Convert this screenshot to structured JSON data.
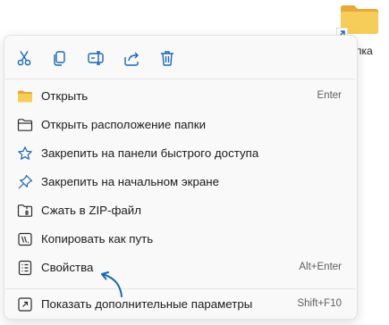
{
  "desktop": {
    "folder_label": "пка"
  },
  "toolbar": {
    "buttons": [
      {
        "icon": "cut-icon",
        "label": "Вырезать"
      },
      {
        "icon": "copy-icon",
        "label": "Копировать"
      },
      {
        "icon": "rename-icon",
        "label": "Переименовать"
      },
      {
        "icon": "share-icon",
        "label": "Поделиться"
      },
      {
        "icon": "delete-icon",
        "label": "Удалить"
      }
    ]
  },
  "menu": {
    "items": [
      {
        "icon": "folder-icon",
        "label": "Открыть",
        "shortcut": "Enter"
      },
      {
        "icon": "folder-outline-icon",
        "label": "Открыть расположение папки",
        "shortcut": ""
      },
      {
        "icon": "star-icon",
        "label": "Закрепить на панели быстрого доступа",
        "shortcut": ""
      },
      {
        "icon": "pin-icon",
        "label": "Закрепить на начальном экране",
        "shortcut": ""
      },
      {
        "icon": "zip-folder-icon",
        "label": "Сжать в ZIP-файл",
        "shortcut": ""
      },
      {
        "icon": "copy-path-icon",
        "label": "Копировать как путь",
        "shortcut": ""
      },
      {
        "icon": "properties-icon",
        "label": "Свойства",
        "shortcut": "Alt+Enter"
      },
      {
        "icon": "more-options-icon",
        "label": "Показать дополнительные параметры",
        "shortcut": "Shift+F10"
      }
    ]
  },
  "colors": {
    "accent": "#1a66b8",
    "folder": "#f3c24f",
    "menu_bg": "#f9f9f9"
  }
}
